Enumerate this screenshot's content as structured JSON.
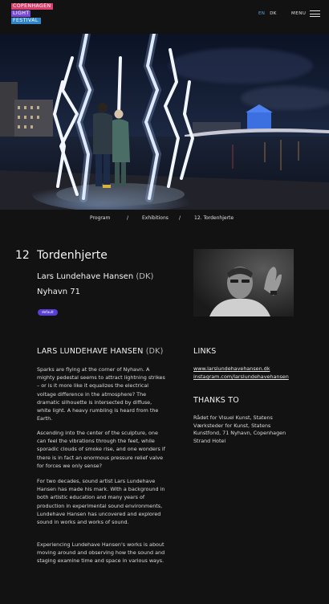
{
  "header": {
    "logo": [
      "COPENHAGEN",
      "LIGHT",
      "FESTIVAL"
    ],
    "lang_en": "EN",
    "lang_dk": "DK",
    "menu_label": "MENU"
  },
  "breadcrumb": {
    "program": "Program",
    "sep": "/",
    "exhibitions": "Exhibitions",
    "current": "12. Tordenhjerte"
  },
  "work": {
    "number": "12",
    "title": "Tordenhjerte",
    "artist": "Lars Lundehave Hansen",
    "artist_country": "(DK)",
    "location": "Nyhavn 71",
    "badge": "default"
  },
  "about": {
    "heading": "LARS LUNDEHAVE HANSEN",
    "heading_country": "(DK)",
    "paragraphs": [
      "Sparks are flying at the corner of Nyhavn. A mighty pedestal seems to attract lightning strikes – or is it more like it equalizes the electrical voltage difference in the atmosphere? The dramatic silhouette is intersected by diffuse, white light. A heavy rumbling is heard from the Earth.",
      "Ascending into the center of the sculpture, one can feel the vibrations through the feet, while sporadic clouds of smoke rise, and one wonders if there is in fact an enormous pressure relief valve for forces we only sense?",
      "For two decades, sound artist Lars Lundehave Hansen has made his mark. With a background in both artistic education and many years of production in experimental sound environments, Lundehave Hansen has uncovered and explored sound in works and works of sound.",
      "Experiencing Lundehave Hansen's works is about moving around and observing how the sound and staging examine time and space in various ways."
    ]
  },
  "links": {
    "heading": "LINKS",
    "items": [
      "www.larslundehavehansen.dk",
      "instagram.com/larslundehavehansen"
    ]
  },
  "thanks": {
    "heading": "THANKS TO",
    "text": "Rådet for Visuel Kunst, Statens Værksteder for Kunst, Statens Kunstfond, 71 Nyhavn, Copenhagen Strand Hotel"
  },
  "colors": {
    "background": "#121212",
    "badge": "#5a3fd6",
    "logo_pink": "#d9416e",
    "logo_purple": "#7a4bd9",
    "logo_blue": "#2f86c9",
    "lang_active": "#5ea3d8"
  }
}
